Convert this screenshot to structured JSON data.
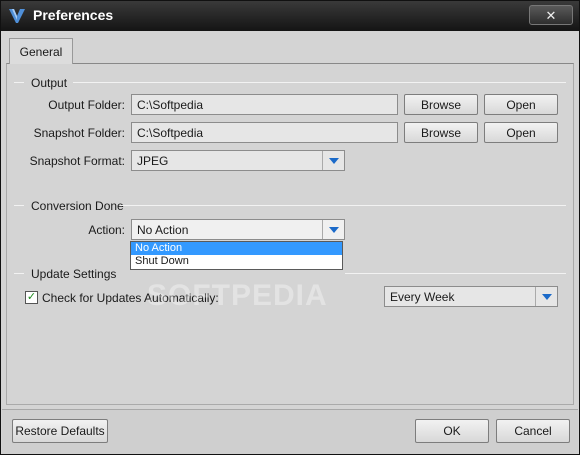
{
  "window": {
    "title": "Preferences",
    "close_glyph": "✕"
  },
  "tabs": [
    {
      "label": "General"
    }
  ],
  "output": {
    "group_title": "Output",
    "output_folder_label": "Output Folder:",
    "output_folder_value": "C:\\Softpedia",
    "snapshot_folder_label": "Snapshot Folder:",
    "snapshot_folder_value": "C:\\Softpedia",
    "snapshot_format_label": "Snapshot Format:",
    "snapshot_format_value": "JPEG",
    "browse_label": "Browse",
    "open_label": "Open"
  },
  "conversion": {
    "group_title": "Conversion Done",
    "action_label": "Action:",
    "action_value": "No Action",
    "options": [
      "No Action",
      "Shut Down"
    ]
  },
  "updates": {
    "group_title": "Update Settings",
    "check_label": "Check for Updates Automatically:",
    "checked": true,
    "frequency_value": "Every Week"
  },
  "watermark": "SOFTPEDIA",
  "footer": {
    "restore_label": "Restore Defaults",
    "ok_label": "OK",
    "cancel_label": "Cancel"
  },
  "colors": {
    "accent": "#1b6ac9",
    "selection": "#3399ff",
    "check": "#1a8a1a"
  },
  "icons": [
    "app-logo-icon",
    "close-icon",
    "dropdown-arrow-icon",
    "checkmark-icon"
  ]
}
